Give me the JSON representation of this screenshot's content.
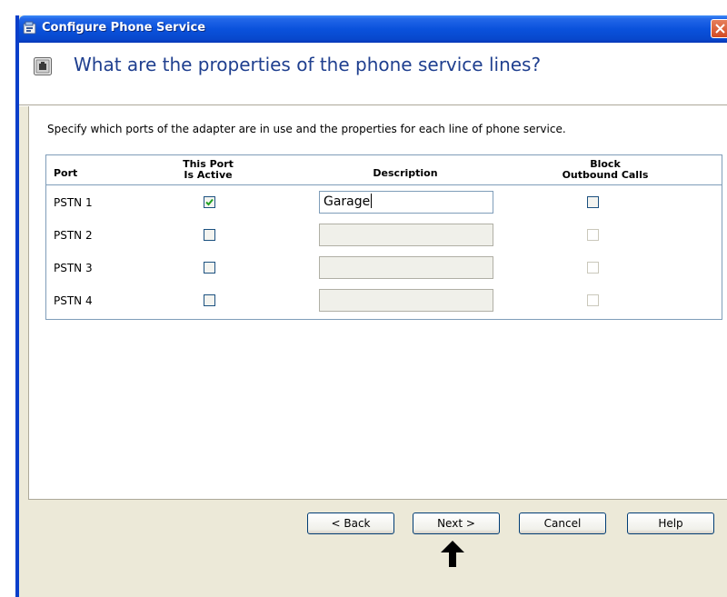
{
  "window": {
    "title": "Configure Phone Service",
    "title_icon": "phone-service-icon",
    "close_icon": "close-icon"
  },
  "header": {
    "title": "What are the properties of the phone service lines?",
    "icon": "phone-adapter-icon"
  },
  "content": {
    "instruction": "Specify which ports of the adapter are in use and the properties for each line of phone service."
  },
  "table": {
    "columns": {
      "port": "Port",
      "active_line1": "This Port",
      "active_line2": "Is Active",
      "description": "Description",
      "block_line1": "Block",
      "block_line2": "Outbound Calls"
    },
    "rows": [
      {
        "port": "PSTN 1",
        "active": true,
        "description": "Garage",
        "description_enabled": true,
        "block": false,
        "block_enabled": true
      },
      {
        "port": "PSTN 2",
        "active": false,
        "description": "",
        "description_enabled": false,
        "block": false,
        "block_enabled": false
      },
      {
        "port": "PSTN 3",
        "active": false,
        "description": "",
        "description_enabled": false,
        "block": false,
        "block_enabled": false
      },
      {
        "port": "PSTN 4",
        "active": false,
        "description": "",
        "description_enabled": false,
        "block": false,
        "block_enabled": false
      }
    ]
  },
  "buttons": {
    "back": "< Back",
    "next": "Next >",
    "cancel": "Cancel",
    "help": "Help"
  },
  "colors": {
    "titlebar": "#0A52DC",
    "header_text": "#1F3F8F",
    "dialog_bg": "#ECE9D8",
    "checkmark": "#21A121"
  }
}
